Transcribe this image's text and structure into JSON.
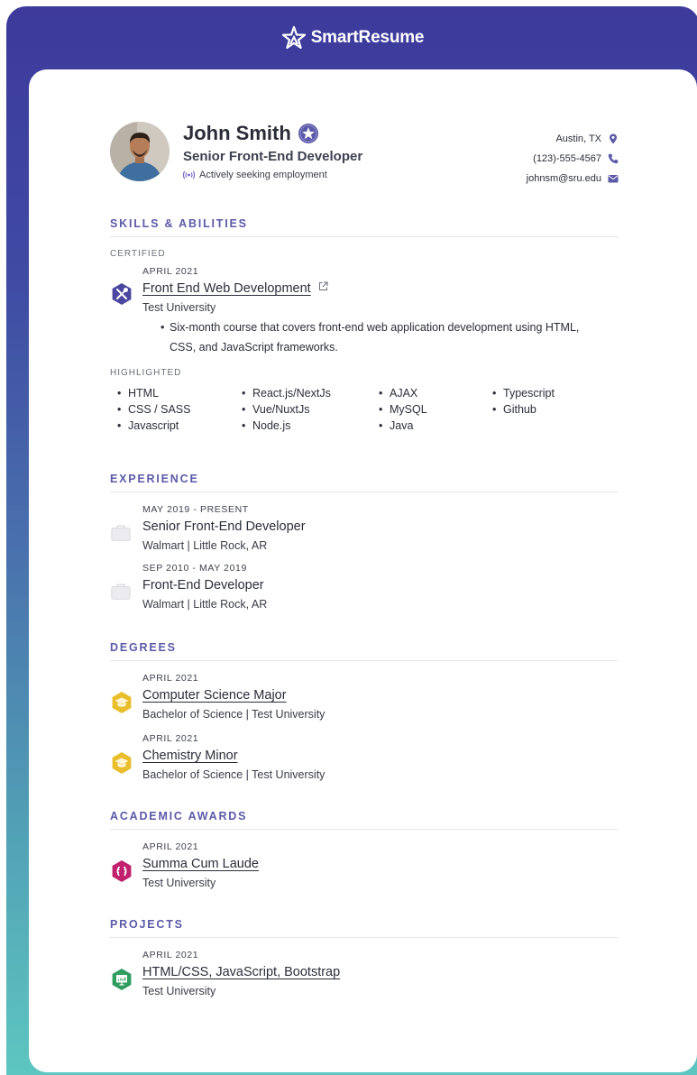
{
  "brand": {
    "name": "SmartResume"
  },
  "profile": {
    "name": "John Smith",
    "title": "Senior Front-End Developer",
    "status": "Actively seeking employment",
    "location": "Austin, TX",
    "phone": "(123)-555-4567",
    "email": "johnsm@sru.edu"
  },
  "skills": {
    "heading": "SKILLS & ABILITIES",
    "certified_label": "CERTIFIED",
    "cert": {
      "date": "APRIL 2021",
      "name": "Front End Web Development",
      "org": "Test University",
      "bullets": [
        "Six-month course that covers front-end web application development using HTML,",
        "CSS, and JavaScript frameworks."
      ]
    },
    "highlighted_label": "HIGHLIGHTED",
    "columns": [
      [
        "HTML",
        "CSS / SASS",
        "Javascript"
      ],
      [
        "React.js/NextJs",
        "Vue/NuxtJs",
        "Node.js"
      ],
      [
        "AJAX",
        "MySQL",
        "Java"
      ],
      [
        "Typescript",
        "Github"
      ]
    ]
  },
  "experience": {
    "heading": "EXPERIENCE",
    "items": [
      {
        "date": "MAY 2019 - PRESENT",
        "role": "Senior Front-End Developer",
        "place": "Walmart | Little Rock, AR"
      },
      {
        "date": "SEP 2010 - MAY 2019",
        "role": "Front-End Developer",
        "place": "Walmart | Little Rock, AR"
      }
    ]
  },
  "degrees": {
    "heading": "DEGREES",
    "items": [
      {
        "date": "APRIL 2021",
        "name": "Computer Science Major",
        "detail": "Bachelor of Science | Test University"
      },
      {
        "date": "APRIL 2021",
        "name": "Chemistry Minor",
        "detail": "Bachelor of Science | Test University"
      }
    ]
  },
  "awards": {
    "heading": "ACADEMIC AWARDS",
    "items": [
      {
        "date": "APRIL 2021",
        "name": "Summa Cum Laude",
        "org": "Test University"
      }
    ]
  },
  "projects": {
    "heading": "PROJECTS",
    "items": [
      {
        "date": "APRIL 2021",
        "name": "HTML/CSS, JavaScript, Bootstrap",
        "org": "Test University"
      }
    ]
  },
  "colors": {
    "accent": "#5b5aa8",
    "cert_icon": "#4b47a0",
    "degree_icon": "#e9be2c",
    "award_icon": "#c0206c",
    "project_icon": "#2f9d5e"
  }
}
